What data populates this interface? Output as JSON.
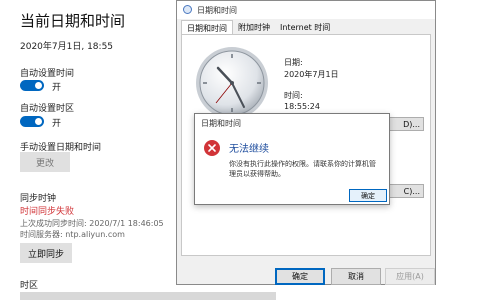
{
  "settings": {
    "title": "当前日期和时间",
    "current_datetime": "2020年7月1日, 18:55",
    "auto_time_label": "自动设置时间",
    "auto_time_state": "开",
    "auto_zone_label": "自动设置时区",
    "auto_zone_state": "开",
    "manual_label": "手动设置日期和时间",
    "change_button": "更改",
    "sync_heading": "同步时钟",
    "sync_failed": "时间同步失败",
    "last_sync": "上次成功同步时间: 2020/7/1 18:46:05",
    "time_server": "时间服务器: ntp.aliyun.com",
    "sync_now_button": "立即同步",
    "timezone_label": "时区",
    "accent_color": "#0067c0",
    "error_color": "#d13438"
  },
  "dialog": {
    "title": "日期和时间",
    "tabs": [
      "日期和时间",
      "附加时钟",
      "Internet 时间"
    ],
    "date_label": "日期:",
    "date_value": "2020年7月1日",
    "time_label": "时间:",
    "time_value": "18:55:24",
    "change_dt_button_fragment": "D)...",
    "change_tz_button_fragment": "C)...",
    "ok_button": "确定",
    "cancel_button": "取消",
    "apply_button": "应用(A)"
  },
  "error_modal": {
    "title": "日期和时间",
    "icon": "error-x-icon",
    "heading": "无法继续",
    "message": "你没有执行此操作的权限。请联系你的计算机管理员以获得帮助。",
    "ok_button": "确定"
  }
}
